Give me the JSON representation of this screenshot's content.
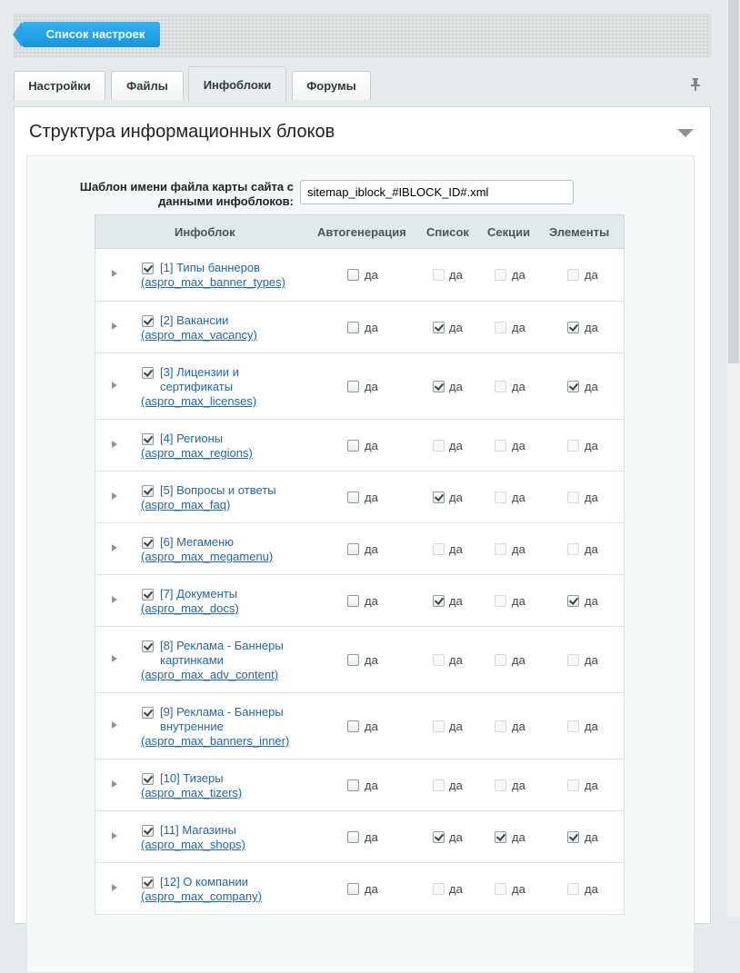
{
  "header": {
    "back_button": "Список настроек"
  },
  "tabs": [
    "Настройки",
    "Файлы",
    "Инфоблоки",
    "Форумы"
  ],
  "active_tab": "Инфоблоки",
  "panel": {
    "title": "Структура информационных блоков",
    "template_label": "Шаблон имени файла карты сайта с данными инфоблоков:",
    "template_value": "sitemap_iblock_#IBLOCK_ID#.xml"
  },
  "table": {
    "columns": [
      "Инфоблок",
      "Автогенерация",
      "Список",
      "Секции",
      "Элементы"
    ],
    "option_label": "да",
    "rows": [
      {
        "title": "[1] Типы баннеров",
        "code": "(aspro_max_banner_types)",
        "included": true,
        "auto": false,
        "list": false,
        "sections": false,
        "elements": false
      },
      {
        "title": "[2] Вакансии",
        "code": "(aspro_max_vacancy)",
        "included": true,
        "auto": false,
        "list": true,
        "sections": false,
        "elements": true
      },
      {
        "title": "[3] Лицензии и сертификаты",
        "code": "(aspro_max_licenses)",
        "included": true,
        "auto": false,
        "list": true,
        "sections": false,
        "elements": true
      },
      {
        "title": "[4] Регионы",
        "code": "(aspro_max_regions)",
        "included": true,
        "auto": false,
        "list": false,
        "sections": false,
        "elements": false
      },
      {
        "title": "[5] Вопросы и ответы",
        "code": "(aspro_max_faq)",
        "included": true,
        "auto": false,
        "list": true,
        "sections": false,
        "elements": false
      },
      {
        "title": "[6] Мегаменю",
        "code": "(aspro_max_megamenu)",
        "included": true,
        "auto": false,
        "list": false,
        "sections": false,
        "elements": false
      },
      {
        "title": "[7] Документы",
        "code": "(aspro_max_docs)",
        "included": true,
        "auto": false,
        "list": true,
        "sections": false,
        "elements": true
      },
      {
        "title": "[8] Реклама - Баннеры картинками",
        "code": "(aspro_max_adv_content)",
        "included": true,
        "auto": false,
        "list": false,
        "sections": false,
        "elements": false
      },
      {
        "title": "[9] Реклама - Баннеры внутренние",
        "code": "(aspro_max_banners_inner)",
        "included": true,
        "auto": false,
        "list": false,
        "sections": false,
        "elements": false
      },
      {
        "title": "[10] Тизеры",
        "code": "(aspro_max_tizers)",
        "included": true,
        "auto": false,
        "list": false,
        "sections": false,
        "elements": false
      },
      {
        "title": "[11] Магазины",
        "code": "(aspro_max_shops)",
        "included": true,
        "auto": false,
        "list": true,
        "sections": true,
        "elements": true
      },
      {
        "title": "[12] О компании",
        "code": "(aspro_max_company)",
        "included": true,
        "auto": false,
        "list": false,
        "sections": false,
        "elements": false
      }
    ]
  }
}
